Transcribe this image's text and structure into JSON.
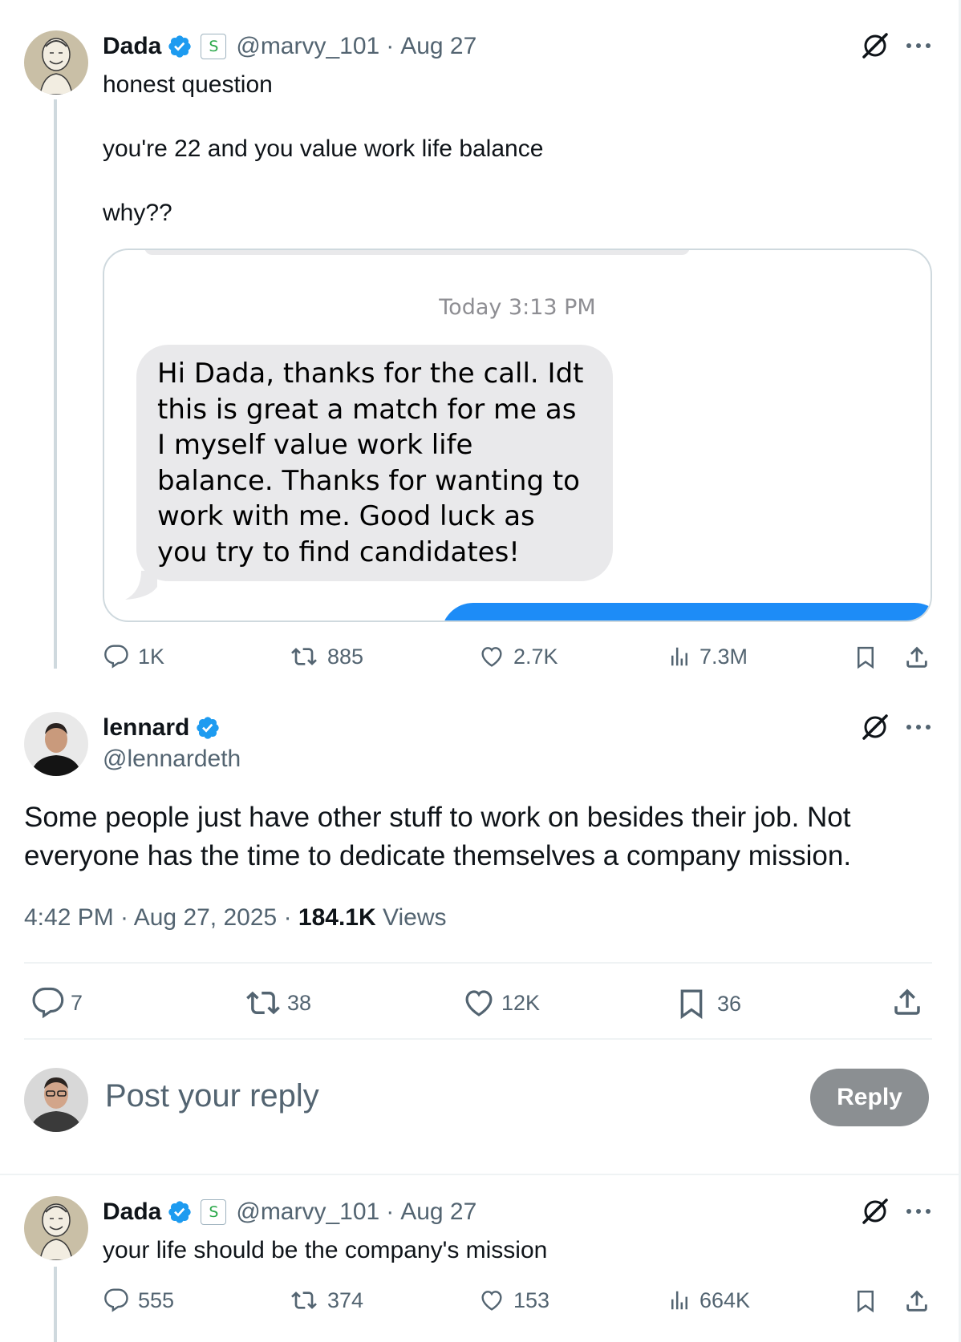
{
  "tweet1": {
    "name": "Dada",
    "handle": "@marvy_101",
    "sep": "·",
    "date": "Aug 27",
    "lines": [
      "honest question",
      "you're 22 and you value work life balance",
      "why??"
    ],
    "image": {
      "time_label": "Today 3:13 PM",
      "bubble_text": "Hi Dada, thanks for the call. Idt this is great a match for me as I myself value work life balance. Thanks for wanting to work with me. Good luck as you try to find candidates!"
    },
    "actions": {
      "replies": "1K",
      "reposts": "885",
      "likes": "2.7K",
      "views": "7.3M"
    }
  },
  "main_tweet": {
    "name": "lennard",
    "handle": "@lennardeth",
    "text": "Some people just have other stuff to work on besides their job. Not everyone has the time to dedicate themselves a company mission.",
    "time": "4:42 PM · Aug 27, 2025",
    "dot": "·",
    "views_count": "184.1K",
    "views_label": "Views",
    "actions": {
      "replies": "7",
      "reposts": "38",
      "likes": "12K",
      "bookmarks": "36"
    }
  },
  "composer": {
    "placeholder": "Post your reply",
    "button_label": "Reply"
  },
  "tweet3": {
    "name": "Dada",
    "handle": "@marvy_101",
    "sep": "·",
    "date": "Aug 27",
    "text": "your life should be the company's mission",
    "actions": {
      "replies": "555",
      "reposts": "374",
      "likes": "153",
      "views": "664K"
    }
  },
  "colors": {
    "verified": "#1d9bf0",
    "text_secondary": "#536471",
    "reply_button_disabled": "#8b8f92",
    "imessage_blue": "#1d8cf7"
  },
  "icons": [
    "verified-badge-icon",
    "subscriber-s-icon",
    "grok-icon",
    "more-icon",
    "reply-icon",
    "repost-icon",
    "like-icon",
    "views-icon",
    "bookmark-icon",
    "share-icon"
  ]
}
